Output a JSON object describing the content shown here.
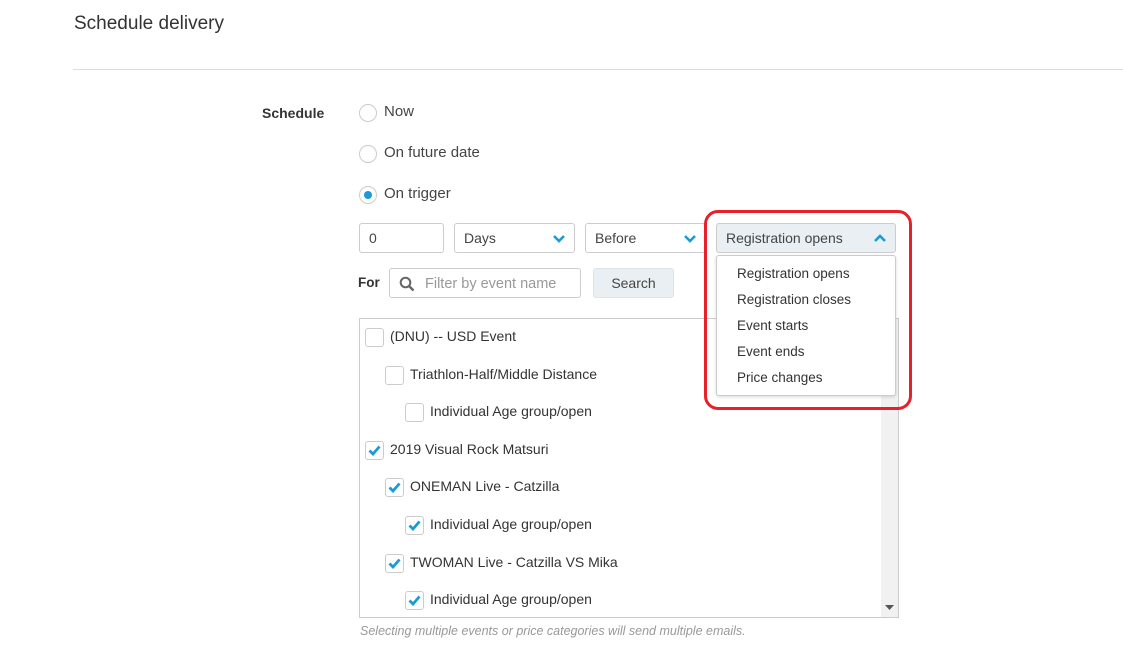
{
  "title": "Schedule delivery",
  "schedule": {
    "label": "Schedule",
    "options": [
      {
        "label": "Now",
        "selected": false
      },
      {
        "label": "On future date",
        "selected": false
      },
      {
        "label": "On trigger",
        "selected": true
      }
    ]
  },
  "trigger": {
    "amount": "0",
    "unit": "Days",
    "relation": "Before",
    "event": "Registration opens",
    "event_options": [
      "Registration opens",
      "Registration closes",
      "Event starts",
      "Event ends",
      "Price changes"
    ]
  },
  "filter": {
    "label": "For",
    "placeholder": "Filter by event name",
    "search_label": "Search"
  },
  "events": [
    {
      "label": "(DNU) -- USD Event",
      "level": 0,
      "checked": false
    },
    {
      "label": "Triathlon-Half/Middle Distance",
      "level": 1,
      "checked": false
    },
    {
      "label": "Individual Age group/open",
      "level": 2,
      "checked": false
    },
    {
      "label": "2019 Visual Rock Matsuri",
      "level": 0,
      "checked": true
    },
    {
      "label": "ONEMAN Live - Catzilla",
      "level": 1,
      "checked": true
    },
    {
      "label": "Individual Age group/open",
      "level": 2,
      "checked": true
    },
    {
      "label": "TWOMAN Live - Catzilla VS Mika",
      "level": 1,
      "checked": true
    },
    {
      "label": "Individual Age group/open",
      "level": 2,
      "checked": true
    }
  ],
  "hint": "Selecting multiple events or price categories will send multiple emails.",
  "colors": {
    "accent": "#1a9bd7",
    "annotation": "#e8202a"
  }
}
